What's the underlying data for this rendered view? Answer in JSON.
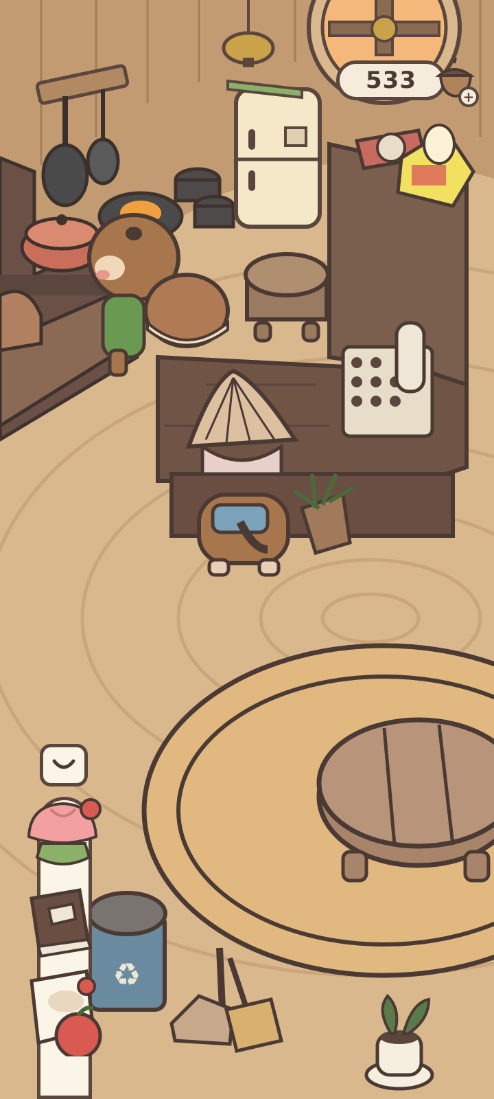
{
  "hud": {
    "currency_value": "533",
    "currency_icon": "acorn-coin-icon",
    "add_icon": "plus-icon"
  },
  "side_panel": {
    "collapse_icon": "chevron-down-icon",
    "items": [
      {
        "name": "cake-item",
        "icon": "cake-icon"
      },
      {
        "name": "recipe-book-item",
        "icon": "book-icon"
      },
      {
        "name": "paper-note-item",
        "icon": "paper-icon"
      }
    ]
  },
  "colors": {
    "floor": "#d9b88e",
    "outline": "#5a463d",
    "rug": "#e0b880",
    "counter": "#7a5e4e",
    "panel": "#fbf5e8"
  }
}
